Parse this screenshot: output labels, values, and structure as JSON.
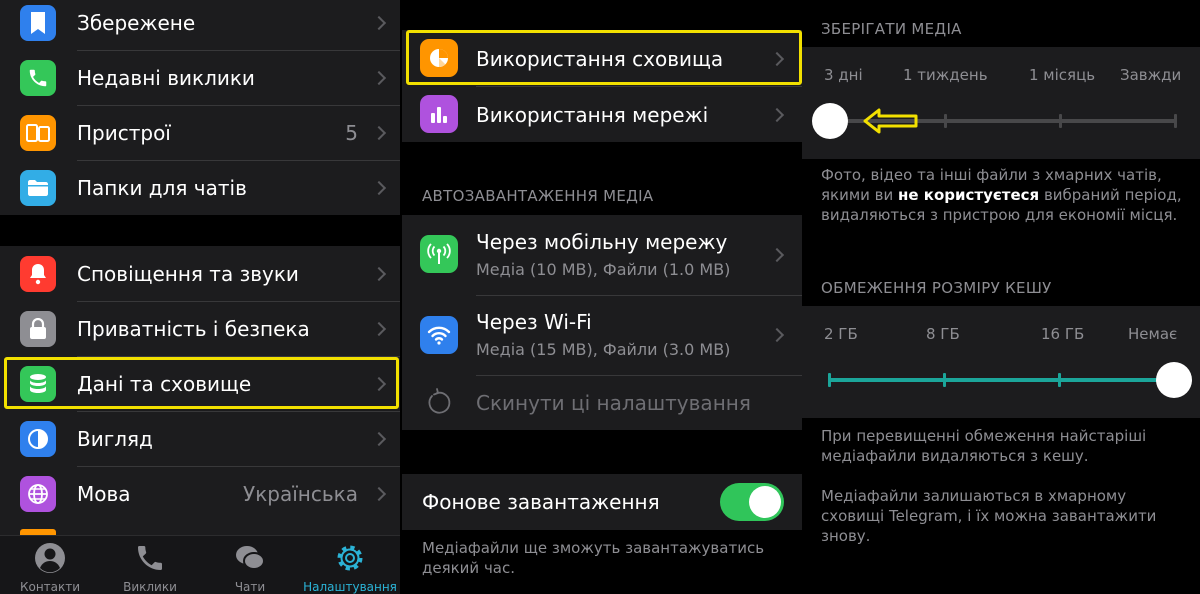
{
  "settings_list": {
    "group1": [
      {
        "label": "Збережене",
        "icon": "bookmark-icon",
        "color": "#2f80ed"
      },
      {
        "label": "Недавні виклики",
        "icon": "phone-icon",
        "color": "#34c759"
      },
      {
        "label": "Пристрої",
        "icon": "devices-icon",
        "color": "#ff9500",
        "value": "5"
      },
      {
        "label": "Папки для чатів",
        "icon": "folder-icon",
        "color": "#32ade6"
      }
    ],
    "group2": [
      {
        "label": "Сповіщення та звуки",
        "icon": "bell-icon",
        "color": "#ff3b30"
      },
      {
        "label": "Приватність і безпека",
        "icon": "lock-icon",
        "color": "#8e8e93"
      },
      {
        "label": "Дані та сховище",
        "icon": "database-icon",
        "color": "#34c759"
      },
      {
        "label": "Вигляд",
        "icon": "appearance-icon",
        "color": "#2f80ed"
      },
      {
        "label": "Мова",
        "icon": "globe-icon",
        "color": "#af52de",
        "value": "Українська"
      }
    ]
  },
  "tabbar": {
    "tabs": [
      {
        "label": "Контакти",
        "icon": "person-icon"
      },
      {
        "label": "Виклики",
        "icon": "phone-icon"
      },
      {
        "label": "Чати",
        "icon": "chats-icon"
      },
      {
        "label": "Налаштування",
        "icon": "gear-icon"
      }
    ],
    "active_color": "#2bb3d6"
  },
  "data_storage": {
    "storage_usage": "Використання сховища",
    "network_usage": "Використання мережі",
    "autodownload_header": "АВТОЗАВАНТАЖЕННЯ МЕДІА",
    "cellular": {
      "label": "Через мобільну мережу",
      "sub": "Медіа (10 MB), Файли (1.0 MB)"
    },
    "wifi": {
      "label": "Через Wi-Fi",
      "sub": "Медіа (15 MB), Файли (3.0 MB)"
    },
    "reset": "Скинути ці налаштування",
    "background_download": "Фонове завантаження",
    "background_download_on": true,
    "background_note": "Медіафайли ще зможуть завантажуватись деякий час."
  },
  "storage": {
    "keep_media_header": "ЗБЕРІГАТИ МЕДІА",
    "keep_media_ticks": [
      "3 дні",
      "1 тиждень",
      "1 місяць",
      "Завжди"
    ],
    "keep_media_selected_index": 0,
    "keep_media_note_1": "Фото, відео та інші файли з хмарних чатів, якими ви ",
    "keep_media_note_bold": "не користуєтеся",
    "keep_media_note_2": " вибраний період, видаляються з пристрою для економії місця.",
    "cache_header": "ОБМЕЖЕННЯ РОЗМІРУ КЕШУ",
    "cache_ticks": [
      "2 ГБ",
      "8 ГБ",
      "16 ГБ",
      "Немає"
    ],
    "cache_selected_index": 3,
    "cache_note_1": "При перевищенні обмеження найстаріші медіафайли видаляються з кешу.",
    "cache_note_2": "Медіафайли залишаються в хмарному сховищі Telegram, і їх можна завантажити знову.",
    "accent_color": "#1ba59a",
    "highlight_color": "#f2e000"
  }
}
